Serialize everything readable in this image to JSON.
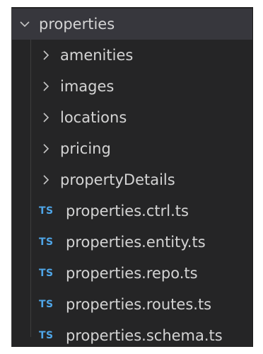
{
  "explorer": {
    "root": {
      "label": "properties",
      "expanded": true
    },
    "folders": [
      {
        "label": "amenities"
      },
      {
        "label": "images"
      },
      {
        "label": "locations"
      },
      {
        "label": "pricing"
      },
      {
        "label": "propertyDetails"
      }
    ],
    "files": [
      {
        "badge": "TS",
        "label": "properties.ctrl.ts"
      },
      {
        "badge": "TS",
        "label": "properties.entity.ts"
      },
      {
        "badge": "TS",
        "label": "properties.repo.ts"
      },
      {
        "badge": "TS",
        "label": "properties.routes.ts"
      },
      {
        "badge": "TS",
        "label": "properties.schema.ts"
      }
    ]
  },
  "colors": {
    "background": "#252526",
    "selected": "#37373d",
    "text": "#d4d4d4",
    "ts_badge": "#4fa6e8"
  }
}
